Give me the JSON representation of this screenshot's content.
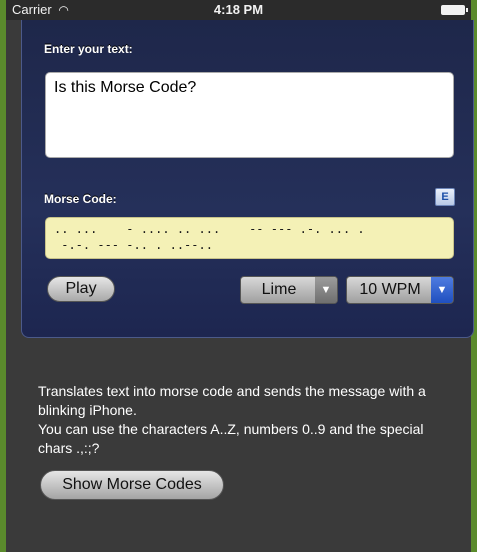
{
  "status_bar": {
    "carrier": "Carrier",
    "time": "4:18 PM"
  },
  "labels": {
    "enter_text": "Enter your text:",
    "morse_code": "Morse Code:"
  },
  "input": {
    "value": "Is this Morse Code?"
  },
  "email_icon": {
    "text": "E",
    "icon": "email-icon"
  },
  "morse_output": ".. ...    - .... .. ...    -- --- .-. ... .\n -.-. --- -.. . ..--..",
  "controls": {
    "play_label": "Play",
    "color_select": "Lime",
    "speed_select": "10 WPM"
  },
  "description": {
    "line1": "Translates text into morse code and sends the message with a blinking iPhone.",
    "line2": "You can use the characters A..Z, numbers 0..9 and the special chars .,:;?"
  },
  "show_codes_label": "Show Morse Codes"
}
